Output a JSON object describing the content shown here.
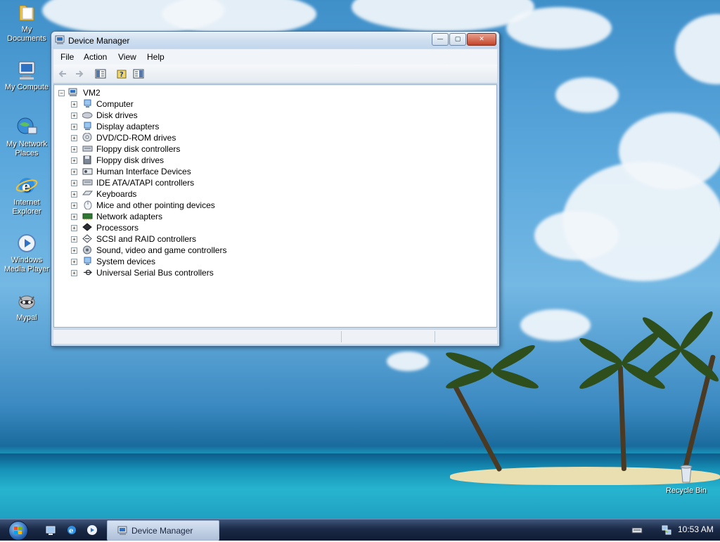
{
  "desktop": {
    "icons": [
      {
        "label_1": "My",
        "label_2": "Documents"
      },
      {
        "label_1": "My Compute",
        "label_2": ""
      },
      {
        "label_1": "My Network",
        "label_2": "Places"
      },
      {
        "label_1": "Internet",
        "label_2": "Explorer"
      },
      {
        "label_1": "Windows",
        "label_2": "Media Player"
      },
      {
        "label_1": "Mypal",
        "label_2": ""
      },
      {
        "label_1": "Recycle Bin",
        "label_2": ""
      }
    ]
  },
  "window": {
    "title": "Device Manager",
    "controls": {
      "minimize": "—",
      "maximize": "▢",
      "close": "✕"
    },
    "menu": [
      "File",
      "Action",
      "View",
      "Help"
    ],
    "toolbar": [
      "back-icon",
      "forward-icon",
      "show-hide-tree-icon",
      "help-icon",
      "properties-icon"
    ],
    "tree": {
      "root": "VM2",
      "items": [
        {
          "label": "Computer",
          "icon": "computer-icon"
        },
        {
          "label": "Disk drives",
          "icon": "disk-drive-icon"
        },
        {
          "label": "Display adapters",
          "icon": "display-adapter-icon"
        },
        {
          "label": "DVD/CD-ROM drives",
          "icon": "dvd-drive-icon"
        },
        {
          "label": "Floppy disk controllers",
          "icon": "floppy-controller-icon"
        },
        {
          "label": "Floppy disk drives",
          "icon": "floppy-drive-icon"
        },
        {
          "label": "Human Interface Devices",
          "icon": "hid-icon"
        },
        {
          "label": "IDE ATA/ATAPI controllers",
          "icon": "ide-controller-icon"
        },
        {
          "label": "Keyboards",
          "icon": "keyboard-icon"
        },
        {
          "label": "Mice and other pointing devices",
          "icon": "mouse-icon"
        },
        {
          "label": "Network adapters",
          "icon": "network-adapter-icon"
        },
        {
          "label": "Processors",
          "icon": "processor-icon"
        },
        {
          "label": "SCSI and RAID controllers",
          "icon": "scsi-controller-icon"
        },
        {
          "label": "Sound, video and game controllers",
          "icon": "sound-icon"
        },
        {
          "label": "System devices",
          "icon": "system-devices-icon"
        },
        {
          "label": "Universal Serial Bus controllers",
          "icon": "usb-icon"
        }
      ]
    }
  },
  "taskbar": {
    "task_label": "Device Manager",
    "clock": "10:53 AM"
  }
}
